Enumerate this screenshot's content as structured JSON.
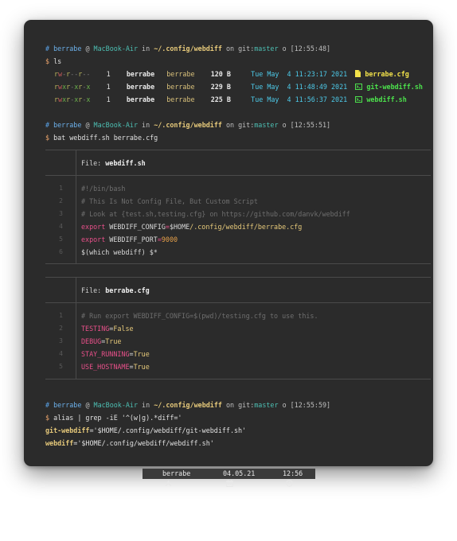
{
  "prompt1": {
    "hash": "#",
    "user": "berrabe",
    "at": "@",
    "host": "MacBook-Air",
    "in": "in",
    "path": "~/.config/webdiff",
    "on": "on",
    "git_label": "git:",
    "branch": "master",
    "circle": "o",
    "time": "[12:55:48]"
  },
  "cmd1": {
    "dollar": "$",
    "text": "ls"
  },
  "ls_rows": [
    {
      "perm": "rw-r--r--",
      "links": "1",
      "owner": "berrabe",
      "group": "berrabe",
      "size": "120 B",
      "date": "Tue May  4 11:23:17 2021",
      "icon": "file-icon",
      "name": "berrabe.cfg",
      "kind": "cfg"
    },
    {
      "perm": "rwxr-xr-x",
      "links": "1",
      "owner": "berrabe",
      "group": "berrabe",
      "size": "229 B",
      "date": "Tue May  4 11:48:49 2021",
      "icon": "terminal-icon",
      "name": "git-webdiff.sh",
      "kind": "sh"
    },
    {
      "perm": "rwxr-xr-x",
      "links": "1",
      "owner": "berrabe",
      "group": "berrabe",
      "size": "225 B",
      "date": "Tue May  4 11:56:37 2021",
      "icon": "terminal-icon",
      "name": "webdiff.sh",
      "kind": "sh"
    }
  ],
  "prompt2": {
    "hash": "#",
    "user": "berrabe",
    "at": "@",
    "host": "MacBook-Air",
    "in": "in",
    "path": "~/.config/webdiff",
    "on": "on",
    "git_label": "git:",
    "branch": "master",
    "circle": "o",
    "time": "[12:55:51]"
  },
  "cmd2": {
    "dollar": "$",
    "text": "bat webdiff.sh berrabe.cfg"
  },
  "file1": {
    "label": "File: ",
    "name": "webdiff.sh",
    "lines": [
      {
        "n": "1",
        "parts": [
          {
            "c": "cmt",
            "t": "#!/bin/bash"
          }
        ]
      },
      {
        "n": "2",
        "parts": [
          {
            "c": "cmt",
            "t": "# This Is Not Config File, But Custom Script"
          }
        ]
      },
      {
        "n": "3",
        "parts": [
          {
            "c": "cmt",
            "t": "# Look at {test.sh,testing.cfg} on https://github.com/danvk/webdiff"
          }
        ]
      },
      {
        "n": "4",
        "parts": [
          {
            "c": "kw",
            "t": "export "
          },
          {
            "c": "plain",
            "t": "WEBDIFF_CONFIG"
          },
          {
            "c": "op",
            "t": "="
          },
          {
            "c": "plain",
            "t": "$HOME"
          },
          {
            "c": "str",
            "t": "/.config/webdiff/berrabe.cfg"
          }
        ]
      },
      {
        "n": "5",
        "parts": [
          {
            "c": "kw",
            "t": "export "
          },
          {
            "c": "plain",
            "t": "WEBDIFF_PORT"
          },
          {
            "c": "op",
            "t": "="
          },
          {
            "c": "num",
            "t": "9000"
          }
        ]
      },
      {
        "n": "6",
        "parts": [
          {
            "c": "plain",
            "t": "$(which webdiff) $*"
          }
        ]
      }
    ]
  },
  "file2": {
    "label": "File: ",
    "name": "berrabe.cfg",
    "lines": [
      {
        "n": "1",
        "parts": [
          {
            "c": "cmt",
            "t": "# Run export WEBDIFF_CONFIG=$(pwd)/testing.cfg to use this."
          }
        ]
      },
      {
        "n": "2",
        "parts": [
          {
            "c": "key",
            "t": "TESTING"
          },
          {
            "c": "plain",
            "t": "="
          },
          {
            "c": "val",
            "t": "False"
          }
        ]
      },
      {
        "n": "3",
        "parts": [
          {
            "c": "key",
            "t": "DEBUG"
          },
          {
            "c": "plain",
            "t": "="
          },
          {
            "c": "val",
            "t": "True"
          }
        ]
      },
      {
        "n": "4",
        "parts": [
          {
            "c": "key",
            "t": "STAY_RUNNING"
          },
          {
            "c": "plain",
            "t": "="
          },
          {
            "c": "val",
            "t": "True"
          }
        ]
      },
      {
        "n": "5",
        "parts": [
          {
            "c": "key",
            "t": "USE_HOSTNAME"
          },
          {
            "c": "plain",
            "t": "="
          },
          {
            "c": "val",
            "t": "True"
          }
        ]
      }
    ]
  },
  "prompt3": {
    "hash": "#",
    "user": "berrabe",
    "at": "@",
    "host": "MacBook-Air",
    "in": "in",
    "path": "~/.config/webdiff",
    "on": "on",
    "git_label": "git:",
    "branch": "master",
    "circle": "o",
    "time": "[12:55:59]"
  },
  "cmd3": {
    "dollar": "$",
    "text": "alias | grep -iE '^(w|g).*diff='"
  },
  "alias_out": [
    {
      "name": "git-webdiff",
      "value": "='$HOME/.config/webdiff/git-webdiff.sh'"
    },
    {
      "name": "webdiff",
      "value": "='$HOME/.config/webdiff/webdiff.sh'"
    }
  ],
  "statusbar": {
    "user_icon": "arch-icon",
    "user": "berrabe",
    "date_icon": "calendar-icon",
    "date": "04.05.21",
    "clock_icon": "clock-icon",
    "time": "12:56"
  }
}
